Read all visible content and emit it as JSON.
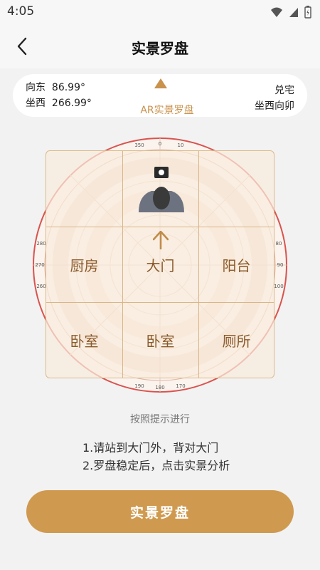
{
  "status_bar": {
    "time": "4:05"
  },
  "nav": {
    "title": "实景罗盘"
  },
  "info": {
    "facing_label": "向东",
    "facing_value": "86.99°",
    "sitting_label": "坐西",
    "sitting_value": "266.99°",
    "house_type": "兑宅",
    "orientation": "坐西向卯",
    "ar_tag": "AR实景罗盘"
  },
  "compass": {
    "degree_labels": [
      "350",
      "0",
      "10",
      "80",
      "90",
      "100",
      "170",
      "180",
      "190",
      "260",
      "270",
      "280"
    ]
  },
  "grid": {
    "cells": [
      "厨房",
      "大门",
      "阳台",
      "卧室",
      "卧室",
      "厕所"
    ]
  },
  "hint": {
    "title": "按照提示进行",
    "step1": "1.请站到大门外，背对大门",
    "step2": "2.罗盘稳定后，点击实景分析"
  },
  "action": {
    "button_label": "实景罗盘"
  },
  "colors": {
    "accent": "#cf9a4f",
    "compass_red": "#d9534f"
  }
}
